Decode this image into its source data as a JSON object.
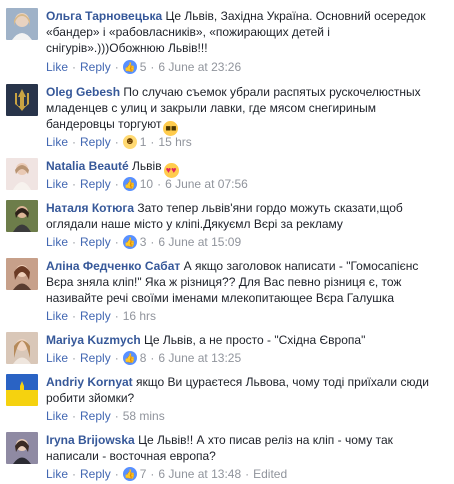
{
  "actions": {
    "like": "Like",
    "reply": "Reply",
    "dot": "·"
  },
  "comments": [
    {
      "name": "Ольга Тарновецька",
      "text": "Це Львів, Західна Україна. Основний осередок «бандер» і «рабовласників», «пожирающих детей і снігурів».)))Обожнюю Львів!!!",
      "reaction": "like-icon",
      "reaction_count": "5",
      "time": "6 June at 23:26"
    },
    {
      "name": "Oleg Gebesh",
      "text": "По случаю съемок убрали распятых рускочелюстных младенцев с улиц и закрыли лавки, где мясом снегириным бандеровцы торгуют",
      "emoji": "sunglasses-emoji",
      "reaction": "haha-icon",
      "reaction_count": "1",
      "time": "15 hrs"
    },
    {
      "name": "Natalia Beauté",
      "text": "Львів",
      "emoji": "heart-eyes-emoji",
      "reaction": "like-icon",
      "reaction_count": "10",
      "time": "6 June at 07:56"
    },
    {
      "name": "Наталя Котюга",
      "text": "Зато тепер львів'яни гордо можуть сказати,щоб оглядали наше місто у кліпі.Дякуємл Вєрі за рекламу",
      "reaction": "like-icon",
      "reaction_count": "3",
      "time": "6 June at 15:09"
    },
    {
      "name": "Аліна Федченко Сабат",
      "text": "А якщо заголовок написати - \"Гомосапієнс Вєра зняла кліп!\" Яка ж різниця?? Для Вас певно різниця є, тож називайте речі своїми іменами млекопитающее Вєра Галушка",
      "time": "16 hrs"
    },
    {
      "name": "Mariya Kuzmych",
      "text": "Це Львів, а не просто - \"Східна Європа\"",
      "reaction": "like-icon",
      "reaction_count": "8",
      "time": "6 June at 13:25"
    },
    {
      "name": "Andriy Kornyat",
      "text": "якщо Ви цураєтеся Львова, чому тоді приїхали сюди робити зйомки?",
      "time": "58 mins"
    },
    {
      "name": "Iryna Brijowska",
      "text": "Це Львів!! А хто писав реліз на кліп - чому так написали - восточная европа?",
      "reaction": "like-icon",
      "reaction_count": "7",
      "time": "6 June at 13:48",
      "edited": "Edited"
    }
  ]
}
